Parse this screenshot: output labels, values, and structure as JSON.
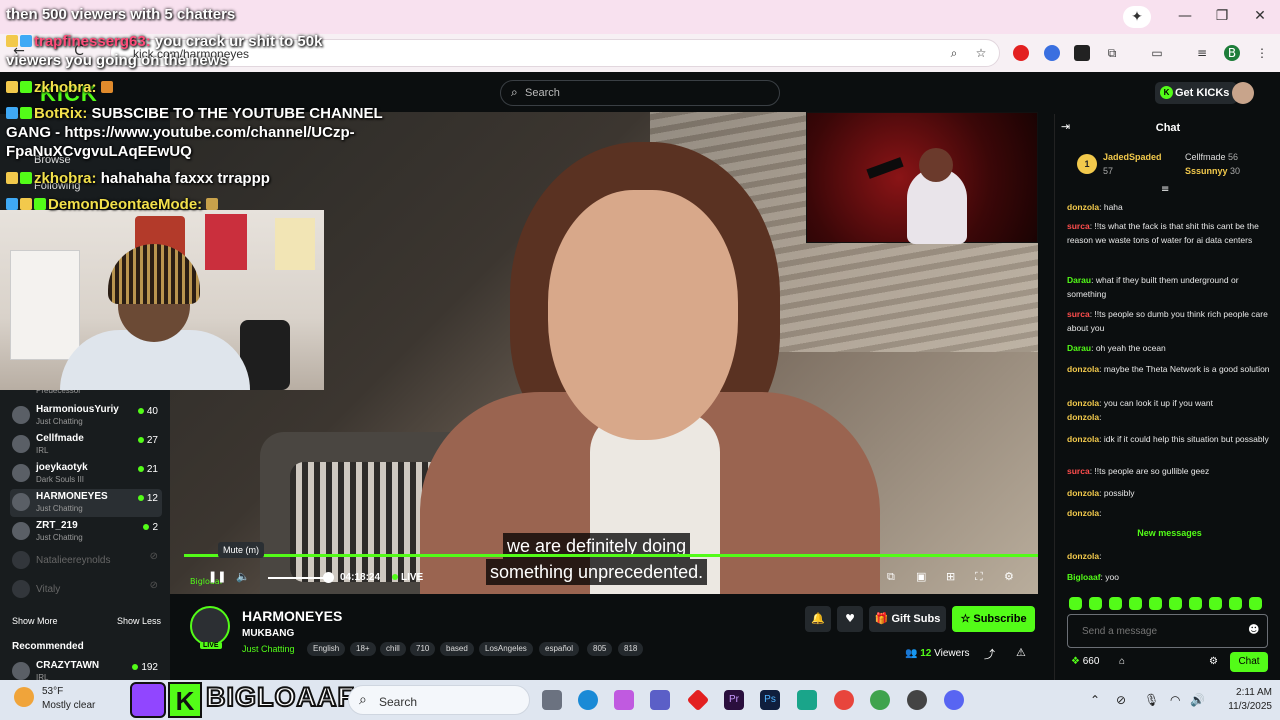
{
  "browser": {
    "url": "kick.com/harmoneyes",
    "nav_back": "←",
    "nav_reload": "C",
    "window_min": "—",
    "window_max": "❐",
    "window_close": "✕",
    "sparkle": "✦",
    "profile_initial": "B"
  },
  "header": {
    "logo": "KICK",
    "search_placeholder": "Search",
    "get_kicks": "Get KICKs"
  },
  "overlay_chat": [
    {
      "user": "",
      "text": "then 500 viewers with 5 chatters"
    },
    {
      "user": "trapfinesserg63:",
      "text": "you crack ur shit to 50k"
    },
    {
      "user": "",
      "text": "viewers you going on the news"
    },
    {
      "user": "zkhobra:",
      "text": ""
    },
    {
      "user": "BotRix:",
      "text": "SUBSCIBE TO THE YOUTUBE CHANNEL"
    },
    {
      "user": "",
      "text": "GANG - https://www.youtube.com/channel/UCzp-"
    },
    {
      "user": "",
      "text": "FpaNuXCvgvuLAqEEwUQ"
    },
    {
      "user": "zkhobra:",
      "text": "hahahaha faxxx trrappp"
    },
    {
      "user": "DemonDeontaeMode:",
      "text": ""
    }
  ],
  "sidebar": {
    "nav": [
      {
        "label": "Browse"
      },
      {
        "label": "Following"
      }
    ],
    "predecessor": "Predecessor",
    "channels": [
      {
        "name": "HarmoniousYuriy",
        "category": "Just Chatting",
        "count": "40",
        "live": true
      },
      {
        "name": "Cellfmade",
        "category": "IRL",
        "count": "27",
        "live": true
      },
      {
        "name": "joeykaotyk",
        "category": "Dark Souls III",
        "count": "21",
        "live": true
      },
      {
        "name": "HARMONEYES",
        "category": "Just Chatting",
        "count": "12",
        "live": true
      },
      {
        "name": "ZRT_219",
        "category": "Just Chatting",
        "count": "2",
        "live": true
      },
      {
        "name": "Natalieereynolds",
        "category": "",
        "count": "",
        "live": false
      },
      {
        "name": "Vitaly",
        "category": "",
        "count": "",
        "live": false
      }
    ],
    "show_more": "Show More",
    "show_less": "Show Less",
    "recommended_label": "Recommended",
    "recommended": [
      {
        "name": "CRAZYTAWN",
        "category": "IRL",
        "count": "192"
      }
    ]
  },
  "video": {
    "subtitle_line1": "we are definitely doing",
    "subtitle_line2": "something unprecedented.",
    "tooltip": "Mute (m)",
    "time": "04:18:24",
    "live_label": "LIVE",
    "watermark": "Bigloaaf",
    "play_icon": "❚❚",
    "volume_icon": "🔈",
    "ctrl_icons": [
      "⧉",
      "▣",
      "⊞",
      "⛶",
      "⚙"
    ]
  },
  "stream_info": {
    "name": "HARMONEYES",
    "title": "MUKBANG",
    "category": "Just Chatting",
    "live_badge": "LIVE",
    "tags": [
      "English",
      "18+",
      "chill",
      "710",
      "based",
      "LosAngeles",
      "español",
      "805",
      "818"
    ],
    "gift_subs": "Gift Subs",
    "subscribe": "Subscribe",
    "viewers_count": "12",
    "viewers_label": "Viewers",
    "bell_icon": "🔔",
    "heart_icon": "♥",
    "share_icon": "⤴",
    "report_icon": "⚠"
  },
  "chat": {
    "title": "Chat",
    "pinned": {
      "rank": "1",
      "user1": "JadedSpaded",
      "user1_count": "57",
      "user2": "Cellfmade",
      "user2_count": "56",
      "user3": "Sssunnyy",
      "user3_count": "30"
    },
    "messages": [
      {
        "user": "donzola",
        "color": "#f2c94c",
        "text": "haha"
      },
      {
        "user": "surca",
        "color": "#ff4d4d",
        "text": "!!ts what the fack is that shit this cant be the reason we waste tons of water for ai data centers"
      },
      {
        "user": "Darau",
        "color": "#53fc18",
        "text": "what if they built them underground or something"
      },
      {
        "user": "surca",
        "color": "#ff4d4d",
        "text": "!!ts people so dumb you think rich people care about you"
      },
      {
        "user": "Darau",
        "color": "#53fc18",
        "text": "oh yeah the ocean"
      },
      {
        "user": "donzola",
        "color": "#f2c94c",
        "text": "maybe the Theta Network is a good solution"
      },
      {
        "user": "donzola",
        "color": "#f2c94c",
        "text": "you can look it up if you want"
      },
      {
        "user": "donzola",
        "color": "#f2c94c",
        "text": ""
      },
      {
        "user": "donzola",
        "color": "#f2c94c",
        "text": "idk if it could help this situation but possably"
      },
      {
        "user": "surca",
        "color": "#ff4d4d",
        "text": "!!ts people are so gullible geez"
      },
      {
        "user": "donzola",
        "color": "#f2c94c",
        "text": "possibly"
      },
      {
        "user": "donzola",
        "color": "#f2c94c",
        "text": ""
      }
    ],
    "new_messages_label": "New messages",
    "new_messages": [
      {
        "user": "donzola",
        "color": "#f2c94c",
        "text": ""
      },
      {
        "user": "Bigloaaf",
        "color": "#53fc18",
        "text": "yoo"
      }
    ],
    "input_placeholder": "Send a message",
    "kicks_balance": "660",
    "send_label": "Chat"
  },
  "taskbar": {
    "temp": "53°F",
    "weather": "Mostly clear",
    "search_placeholder": "Search",
    "logo_text": "BIGLOAAF",
    "time": "2:11 AM",
    "date": "11/3/2025"
  },
  "colors": {
    "accent": "#53fc18",
    "background": "#0b0e0f"
  }
}
